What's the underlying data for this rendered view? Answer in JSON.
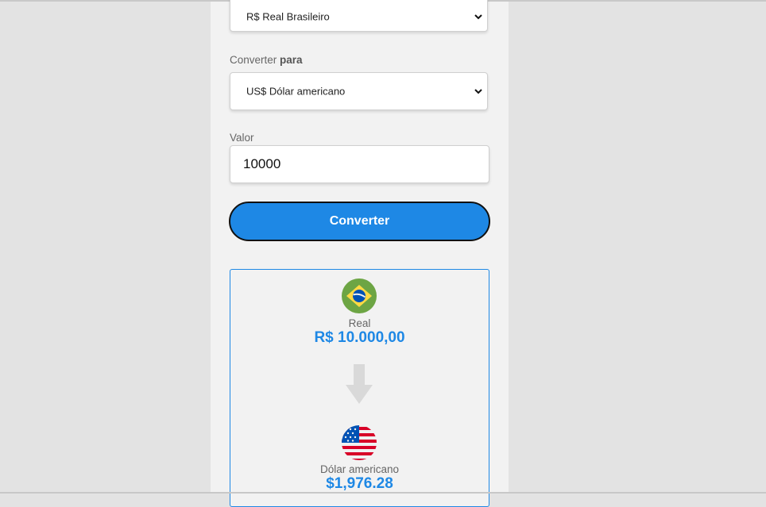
{
  "from_select": {
    "value": "R$ Real Brasileiro"
  },
  "to_label": {
    "prefix": "Converter",
    "bold": "para"
  },
  "to_select": {
    "value": "US$ Dólar americano"
  },
  "amount_label": "Valor",
  "amount_input": {
    "value": "10000"
  },
  "convert_button": "Converter",
  "result": {
    "from_name": "Real",
    "from_value": "R$ 10.000,00",
    "to_name": "Dólar americano",
    "to_value": "$1,976.28"
  },
  "icons": [
    "chevron-down-icon",
    "brazil-flag-icon",
    "arrow-down-icon",
    "usa-flag-icon"
  ],
  "colors": {
    "accent": "#1e88e5",
    "panel": "#f2f2f2",
    "background": "#e3e3e3"
  }
}
